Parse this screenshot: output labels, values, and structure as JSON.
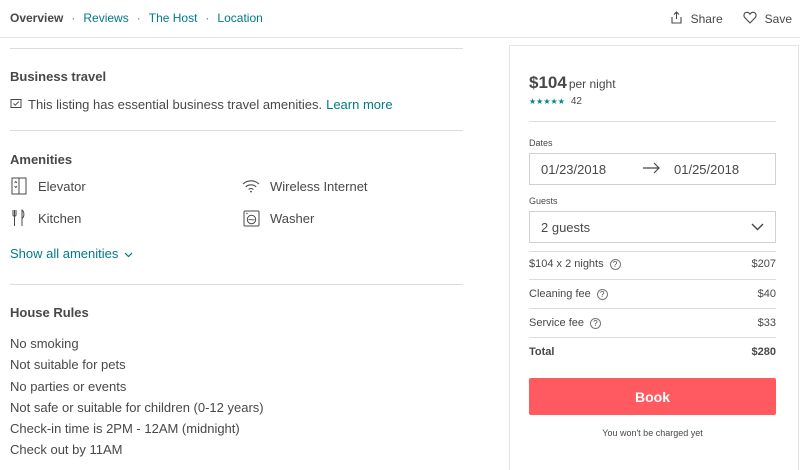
{
  "nav": {
    "links": [
      {
        "label": "Overview"
      },
      {
        "label": "Reviews"
      },
      {
        "label": "The Host"
      },
      {
        "label": "Location"
      }
    ],
    "separator": "·",
    "share_label": "Share",
    "save_label": "Save"
  },
  "business_travel": {
    "title": "Business travel",
    "text": "This listing has essential business travel amenities.",
    "link": "Learn more"
  },
  "amenities": {
    "title": "Amenities",
    "items": [
      {
        "label": "Elevator",
        "icon": "elevator-icon"
      },
      {
        "label": "Wireless Internet",
        "icon": "wifi-icon"
      },
      {
        "label": "Kitchen",
        "icon": "kitchen-icon"
      },
      {
        "label": "Washer",
        "icon": "washer-icon"
      }
    ],
    "show_all": "Show all amenities"
  },
  "house_rules": {
    "title": "House Rules",
    "rules": [
      "No smoking",
      "Not suitable for pets",
      "No parties or events",
      "Not safe or suitable for children (0-12 years)",
      "Check-in time is 2PM - 12AM (midnight)",
      "Check out by 11AM"
    ]
  },
  "booking": {
    "price": "$104",
    "per_night": "per night",
    "stars": "★★★★★",
    "review_count": "42",
    "dates_label": "Dates",
    "check_in": "01/23/2018",
    "check_out": "01/25/2018",
    "guests_label": "Guests",
    "guests_value": "2 guests",
    "fees": [
      {
        "label": "$104 x 2 nights",
        "amount": "$207"
      },
      {
        "label": "Cleaning fee",
        "amount": "$40"
      },
      {
        "label": "Service fee",
        "amount": "$33"
      }
    ],
    "total_label": "Total",
    "total_amount": "$280",
    "book_label": "Book",
    "no_charge": "You won't be charged yet",
    "help_glyph": "?"
  },
  "colors": {
    "accent_teal": "#007a87",
    "book_button": "#ff5a5f",
    "stars": "#008489",
    "text": "#484848"
  }
}
